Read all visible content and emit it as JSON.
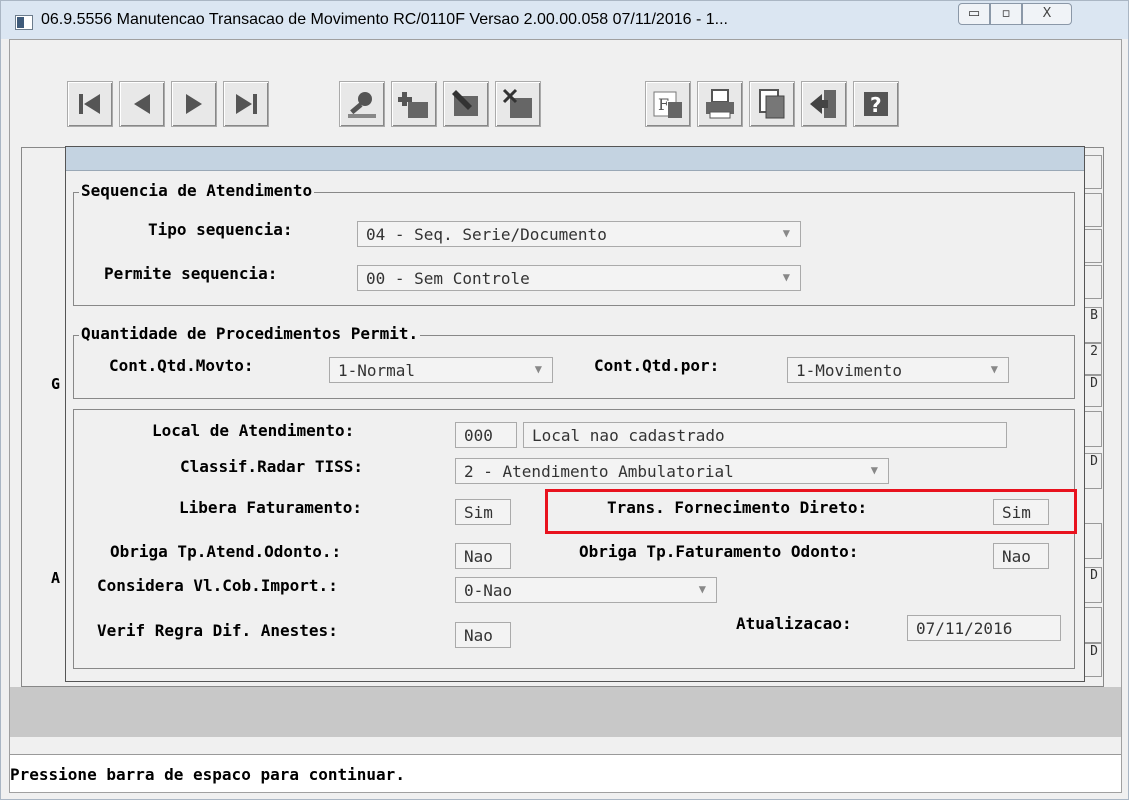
{
  "window": {
    "title": "06.9.5556 Manutencao  Transacao de Movimento RC/0110F Versao 2.00.00.058 07/11/2016 - 1...",
    "minimize_glyph": "▭",
    "maximize_glyph": "▫",
    "close_glyph": "X"
  },
  "toolbar": {
    "buttons": [
      "first-record-icon",
      "prev-record-icon",
      "next-record-icon",
      "last-record-icon",
      "search-icon",
      "add-icon",
      "edit-icon",
      "delete-icon",
      "filter-icon",
      "print-icon",
      "copy-icon",
      "exit-icon",
      "help-icon"
    ]
  },
  "frame": {
    "left_letters": [
      "G",
      "A"
    ],
    "right_letters": [
      "B",
      "2",
      "D",
      "D",
      "D",
      "D",
      "D"
    ]
  },
  "sequencia": {
    "legend": "Sequencia de Atendimento",
    "tipo_label": "Tipo sequencia:",
    "tipo_value": "04 - Seq. Serie/Documento",
    "permite_label": "Permite sequencia:",
    "permite_value": "00 - Sem Controle"
  },
  "quantidade": {
    "legend": "Quantidade de Procedimentos Permit.",
    "movto_label": "Cont.Qtd.Movto:",
    "movto_value": "1-Normal",
    "por_label": "Cont.Qtd.por:",
    "por_value": "1-Movimento"
  },
  "detalhes": {
    "local_label": "Local de Atendimento:",
    "local_code": "000",
    "local_desc": "Local nao cadastrado",
    "radar_label": "Classif.Radar TISS:",
    "radar_value": "2 - Atendimento Ambulatorial",
    "libera_label": "Libera Faturamento:",
    "libera_value": "Sim",
    "trans_label": "Trans. Fornecimento Direto:",
    "trans_value": "Sim",
    "obriga_odonto_label": "Obriga Tp.Atend.Odonto.:",
    "obriga_odonto_value": "Nao",
    "obriga_fat_label": "Obriga Tp.Faturamento Odonto:",
    "obriga_fat_value": "Nao",
    "considera_label": "Considera Vl.Cob.Import.:",
    "considera_value": "0-Nao",
    "verif_label": "Verif Regra Dif. Anestes:",
    "verif_value": "Nao",
    "atualizacao_label": "Atualizacao:",
    "atualizacao_value": "07/11/2016"
  },
  "status_text": "Pressione barra de espaco para continuar.",
  "colors": {
    "highlight": "#e8121e",
    "header": "#c4d3e1"
  }
}
